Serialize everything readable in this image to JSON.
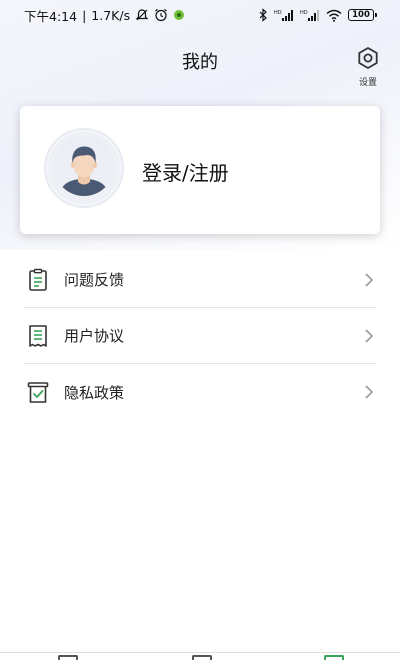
{
  "status_bar": {
    "time": "下午4:14",
    "separator": "|",
    "net_speed": "1.7K/s",
    "battery": "100",
    "icons": [
      "silent-icon",
      "alarm-icon",
      "app-notification-icon",
      "bluetooth-icon",
      "signal-hd-icon",
      "signal-hd-icon",
      "wifi-icon",
      "battery-icon"
    ]
  },
  "header": {
    "title": "我的",
    "settings_label": "设置",
    "settings_icon": "hexagon-gear-icon"
  },
  "profile_card": {
    "avatar_icon": "user-avatar-icon",
    "login_label": "登录/注册"
  },
  "menu": {
    "items": [
      {
        "label": "问题反馈",
        "icon": "clipboard-icon"
      },
      {
        "label": "用户协议",
        "icon": "receipt-icon"
      },
      {
        "label": "隐私政策",
        "icon": "shield-check-icon"
      }
    ]
  },
  "colors": {
    "accent_green": "#3aa55a",
    "text": "#222222",
    "divider": "#e6e6e6"
  }
}
